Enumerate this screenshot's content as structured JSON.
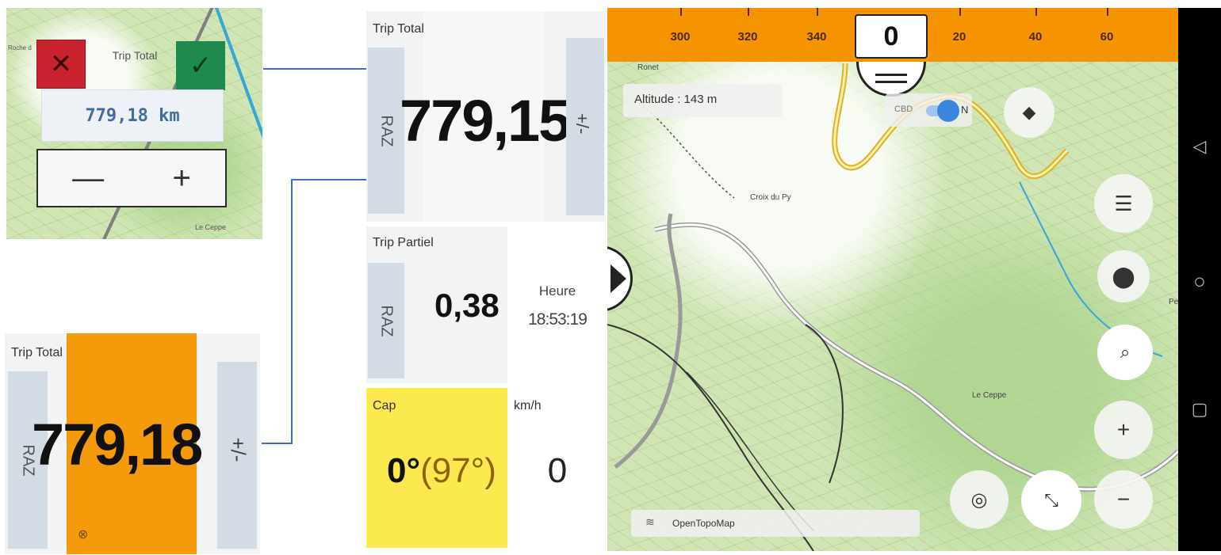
{
  "edit_dialog": {
    "title": "Trip Total",
    "value": "779,18 km",
    "cancel_icon": "✕",
    "ok_icon": "✓",
    "minus": "—",
    "plus": "+",
    "map_label": "Le Ceppe",
    "map_label_2": "Roche d"
  },
  "orange_tile": {
    "label": "Trip Total",
    "raz": "RAZ",
    "value": "779,18",
    "adjust": "+/-",
    "bottom_icon": "⊗",
    "highlight_color": "#f59a0a"
  },
  "dashboard": {
    "trip_total": {
      "label": "Trip Total",
      "raz": "RAZ",
      "value": "779,15",
      "adjust": "+/-"
    },
    "trip_partiel": {
      "label": "Trip Partiel",
      "raz": "RAZ",
      "value": "0,38"
    },
    "clock": {
      "label": "Heure",
      "value": "18:53:19"
    },
    "cap": {
      "label": "Cap",
      "value": "0°",
      "secondary": "(97°)",
      "bg": "#fce94f"
    },
    "speed": {
      "label": "km/h",
      "value": "0"
    }
  },
  "map": {
    "compass_ticks": [
      "300",
      "320",
      "340",
      "0",
      "20",
      "40",
      "60"
    ],
    "heading": "0",
    "altitude": "Altitude : 143 m",
    "toggle_off": "CBD",
    "toggle_on": "N",
    "place_1": "Croix du Py",
    "place_2": "Le Ceppe",
    "place_3": "Pet",
    "place_4": "Ronet",
    "attribution": "OpenTopoMap",
    "accent": "#f59300"
  },
  "nav": {
    "back": "◁",
    "home": "○",
    "recents": "▢"
  }
}
